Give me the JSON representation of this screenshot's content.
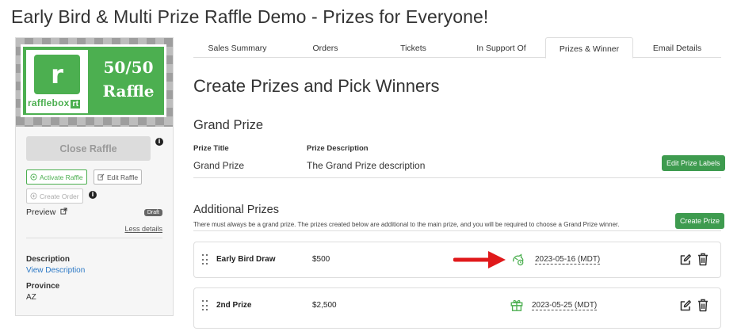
{
  "page": {
    "title": "Early Bird & Multi Prize Raffle Demo - Prizes for Everyone!"
  },
  "sidebar": {
    "logo": {
      "letter": "r",
      "word": "rafflebox",
      "word_badge": "rt"
    },
    "raffle_badge": {
      "line1": "50/50",
      "line2": "Raffle"
    },
    "close_raffle_label": "Close Raffle",
    "activate_raffle_label": "Activate Raffle",
    "edit_raffle_label": "Edit Raffle",
    "create_order_label": "Create Order",
    "preview_label": "Preview",
    "status_badge": "Draft",
    "less_details_label": "Less details",
    "description_label": "Description",
    "view_description_label": "View Description",
    "province_label": "Province",
    "province_value": "AZ"
  },
  "tabs": [
    {
      "label": "Sales Summary",
      "active": false
    },
    {
      "label": "Orders",
      "active": false
    },
    {
      "label": "Tickets",
      "active": false
    },
    {
      "label": "In Support Of",
      "active": false
    },
    {
      "label": "Prizes & Winner",
      "active": true
    },
    {
      "label": "Email Details",
      "active": false
    }
  ],
  "main": {
    "title": "Create Prizes and Pick Winners",
    "grand_prize": {
      "heading": "Grand Prize",
      "title_header": "Prize Title",
      "description_header": "Prize Description",
      "title_value": "Grand Prize",
      "description_value": "The Grand Prize description",
      "edit_labels_button": "Edit Prize Labels"
    },
    "additional": {
      "heading": "Additional Prizes",
      "note": "There must always be a grand prize. The prizes created below are additional to the main prize, and you will be required to choose a Grand Prize winner.",
      "create_button": "Create Prize",
      "prizes": [
        {
          "name": "Early Bird Draw",
          "amount": "$500",
          "date": "2023-05-16 (MDT)",
          "icon": "early-bird-icon"
        },
        {
          "name": "2nd Prize",
          "amount": "$2,500",
          "date": "2023-05-25 (MDT)",
          "icon": "gift-icon"
        }
      ]
    }
  },
  "colors": {
    "brand_green": "#4caf50",
    "button_green": "#3e9b4f",
    "link_blue": "#2b78c5",
    "annotation_red": "#e0191b"
  }
}
